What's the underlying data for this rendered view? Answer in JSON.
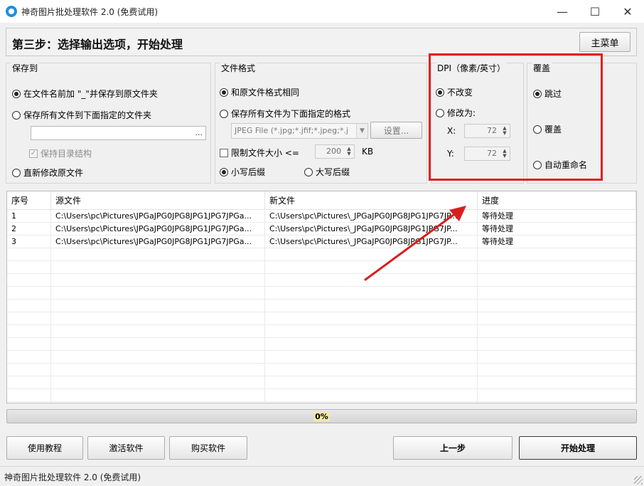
{
  "window": {
    "title": "神奇图片批处理软件 2.0 (免费试用)",
    "minimize": "—",
    "maximize": "☐",
    "close": "✕"
  },
  "step": {
    "title": "第三步：选择输出选项，开始处理",
    "main_menu": "主菜单"
  },
  "save_group": {
    "label": "保存到",
    "opt_prefix": "在文件名前加 \"_\"并保存到原文件夹",
    "opt_folder": "保存所有文件到下面指定的文件夹",
    "folder_value": "",
    "browse": "...",
    "keep_structure": "保持目录结构",
    "opt_overwrite": "直新修改原文件"
  },
  "format_group": {
    "label": "文件格式",
    "opt_same": "和原文件格式相同",
    "opt_specified": "保存所有文件为下面指定的格式",
    "format_value": "JPEG File (*.jpg;*.jfif;*.jpeg;*.j",
    "settings": "设置...",
    "limit_size": "限制文件大小 <=",
    "size_value": "200",
    "size_unit": "KB",
    "lower_ext": "小写后缀",
    "upper_ext": "大写后缀"
  },
  "dpi_group": {
    "label": "DPI（像素/英寸）",
    "opt_keep": "不改变",
    "opt_change": "修改为:",
    "x_label": "X:",
    "x_value": "72",
    "y_label": "Y:",
    "y_value": "72"
  },
  "overwrite_group": {
    "label": "覆盖",
    "opt_skip": "跳过",
    "opt_overwrite": "覆盖",
    "opt_rename": "自动重命名"
  },
  "table": {
    "columns": [
      "序号",
      "源文件",
      "新文件",
      "进度"
    ],
    "rows": [
      [
        "1",
        "C:\\Users\\pc\\Pictures\\JPGaJPG0JPG8JPG1JPG7JPGa...",
        "C:\\Users\\pc\\Pictures\\_JPGaJPG0JPG8JPG1JPG7JP...",
        "等待处理"
      ],
      [
        "2",
        "C:\\Users\\pc\\Pictures\\JPGaJPG0JPG8JPG1JPG7JPGa...",
        "C:\\Users\\pc\\Pictures\\_JPGaJPG0JPG8JPG1JPG7JP...",
        "等待处理"
      ],
      [
        "3",
        "C:\\Users\\pc\\Pictures\\JPGaJPG0JPG8JPG1JPG7JPGa...",
        "C:\\Users\\pc\\Pictures\\_JPGaJPG0JPG8JPG1JPG7JP...",
        "等待处理"
      ]
    ]
  },
  "progress": {
    "value": 0,
    "label": "0%"
  },
  "buttons": {
    "tutorial": "使用教程",
    "activate": "激活软件",
    "buy": "购买软件",
    "prev": "上一步",
    "start": "开始处理"
  },
  "status": {
    "text": "神奇图片批处理软件 2.0 (免费试用)"
  },
  "colors": {
    "highlight": "#e02020",
    "app_icon": "#1e8fe1"
  }
}
